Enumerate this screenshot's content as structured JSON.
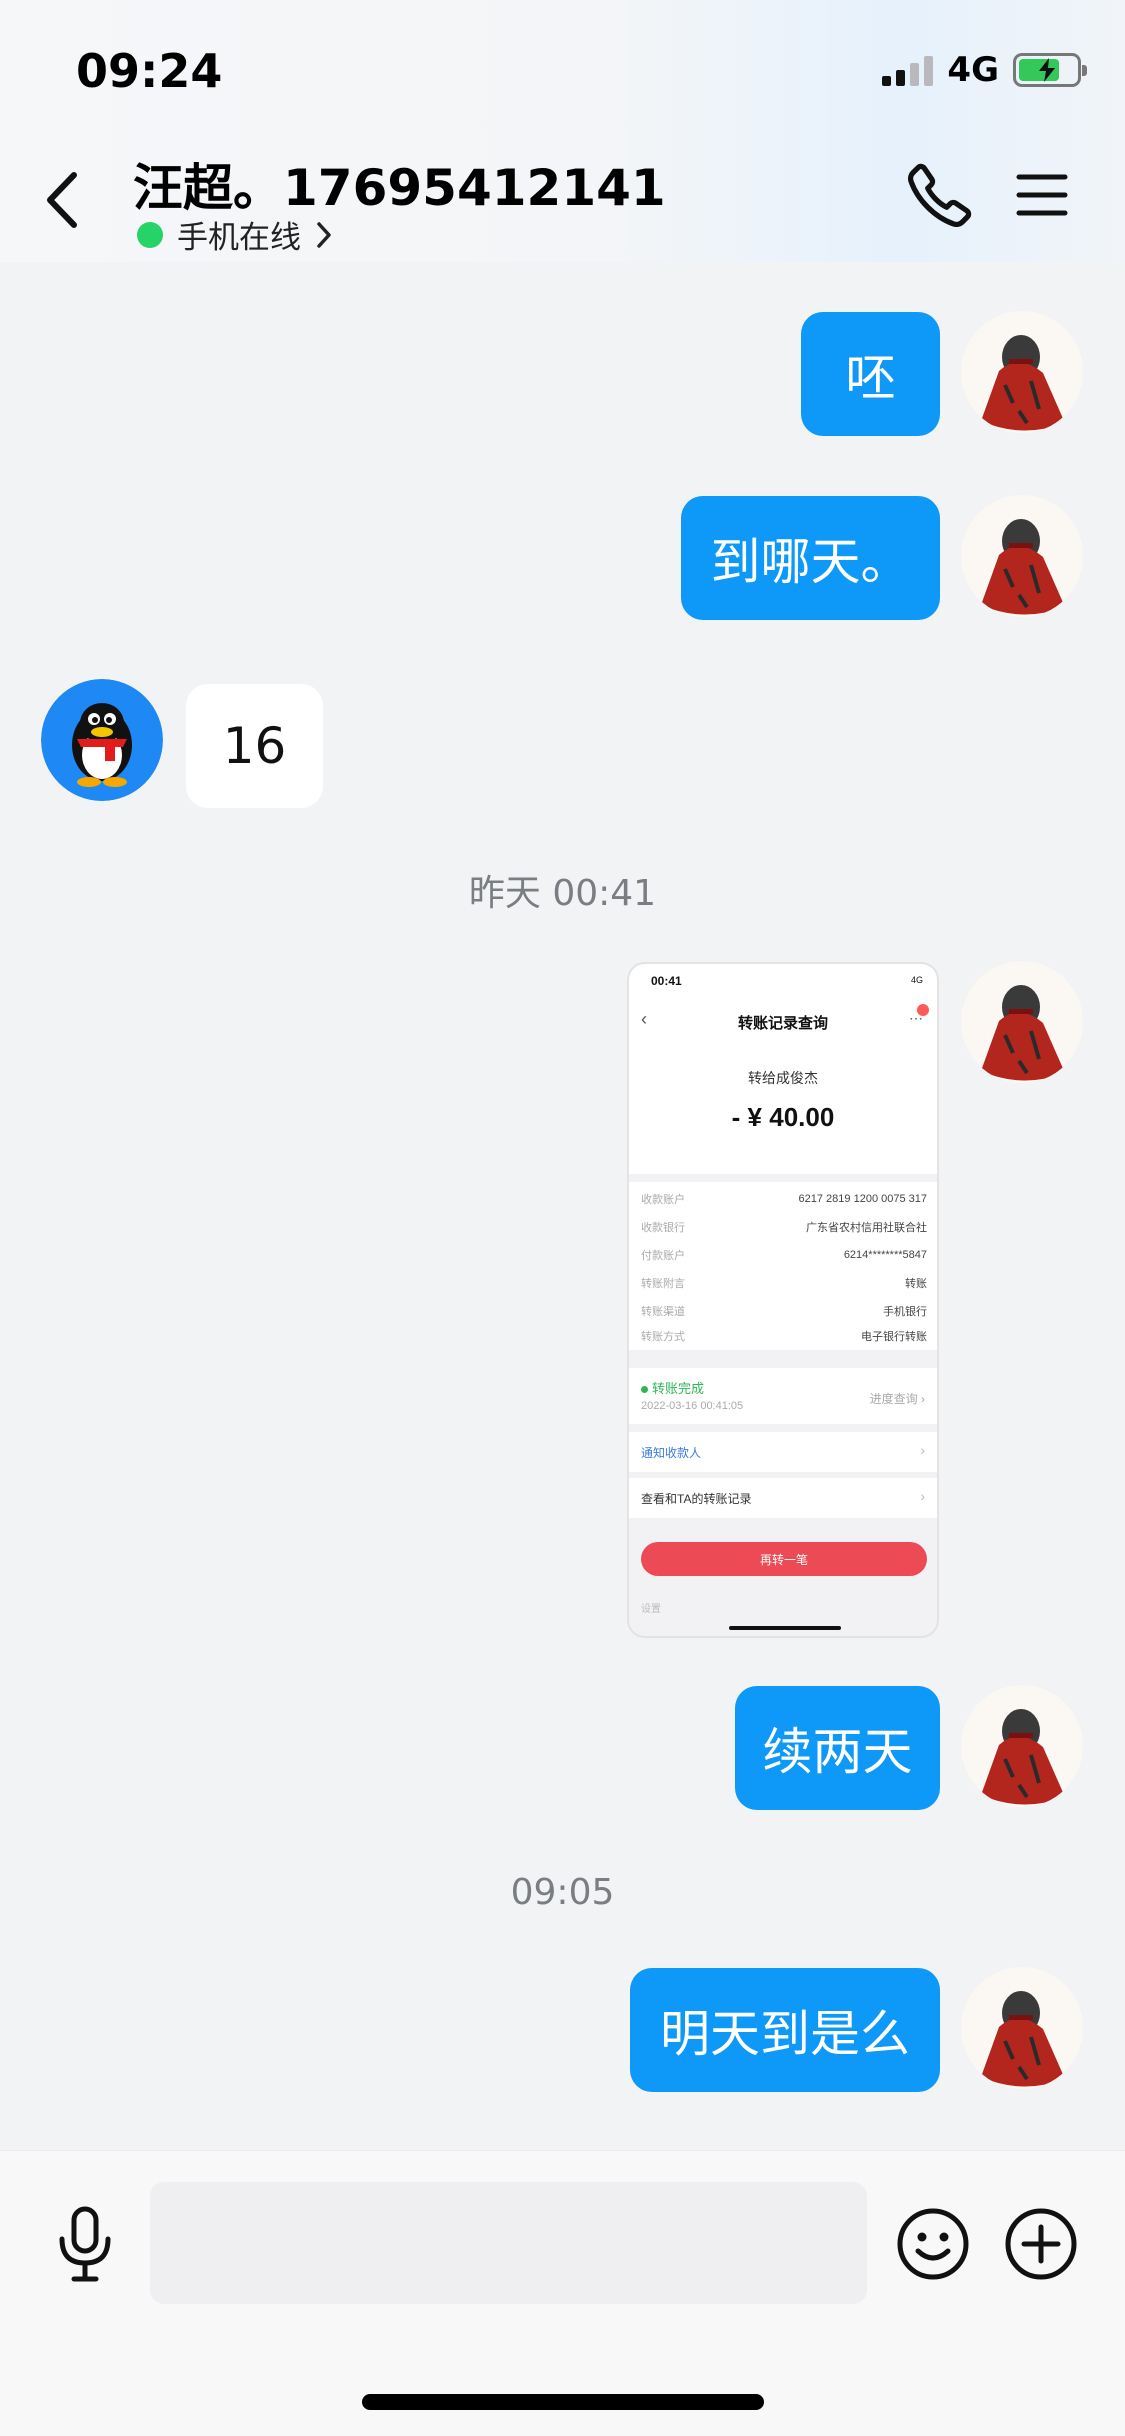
{
  "status_bar": {
    "time": "09:24",
    "network": "4G"
  },
  "header": {
    "contact_name": "汪超。17695412141",
    "presence": "手机在线"
  },
  "messages": [
    {
      "direction": "out",
      "text": "呸"
    },
    {
      "direction": "out",
      "text": "到哪天。"
    },
    {
      "direction": "in",
      "text": "16"
    },
    {
      "separator": "昨天 00:41"
    },
    {
      "direction": "out",
      "type": "image"
    },
    {
      "direction": "out",
      "text": "续两天"
    },
    {
      "separator": "09:05"
    },
    {
      "direction": "out",
      "text": "明天到是么"
    }
  ],
  "screenshot": {
    "time": "00:41",
    "network": "4G",
    "title": "转账记录查询",
    "payee": "转给成俊杰",
    "amount": "- ¥ 40.00",
    "details": [
      {
        "label": "收款账户",
        "value": "6217 2819 1200 0075 317"
      },
      {
        "label": "收款银行",
        "value": "广东省农村信用社联合社"
      },
      {
        "label": "付款账户",
        "value": "6214********5847"
      },
      {
        "label": "转账附言",
        "value": "转账"
      },
      {
        "label": "转账渠道",
        "value": "手机银行"
      },
      {
        "label": "转账方式",
        "value": "电子银行转账"
      }
    ],
    "status": "转账完成",
    "status_time": "2022-03-16 00:41:05",
    "progress_link": "进度查询 ›",
    "notify": "通知收款人",
    "history": "查看和TA的转账记录",
    "transfer_again": "再转一笔",
    "more": "设置"
  },
  "input": {
    "placeholder": ""
  },
  "colors": {
    "outgoing_bubble": "#0e98f8",
    "incoming_bubble": "#ffffff",
    "online": "#25d366",
    "background": "#f2f3f5"
  },
  "icons": [
    "back-icon",
    "phone-icon",
    "menu-icon",
    "microphone-icon",
    "emoji-icon",
    "plus-icon",
    "chevron-right-icon",
    "qq-penguin-avatar",
    "user-avatar"
  ]
}
